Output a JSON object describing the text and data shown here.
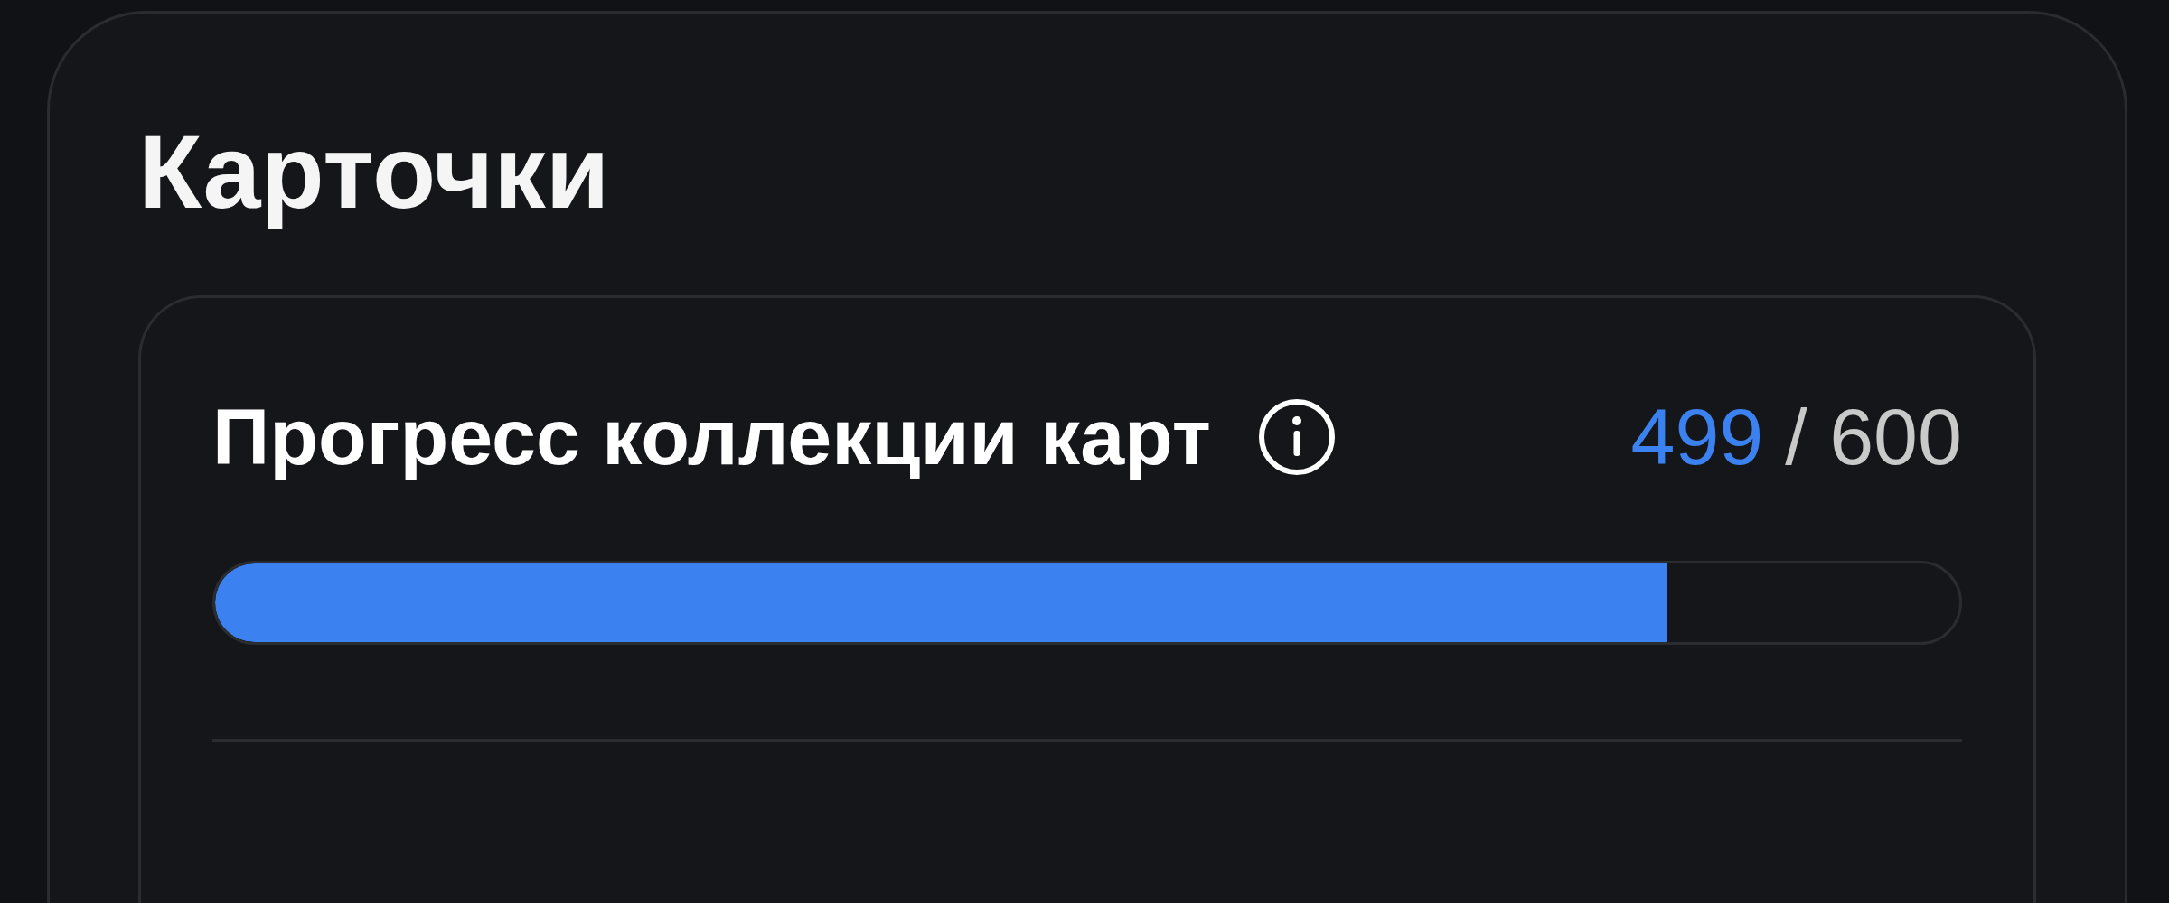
{
  "section": {
    "title": "Карточки"
  },
  "collection_progress": {
    "label": "Прогресс коллекции карт",
    "collected": "499",
    "total": "/ 600",
    "level": 0.832
  }
}
